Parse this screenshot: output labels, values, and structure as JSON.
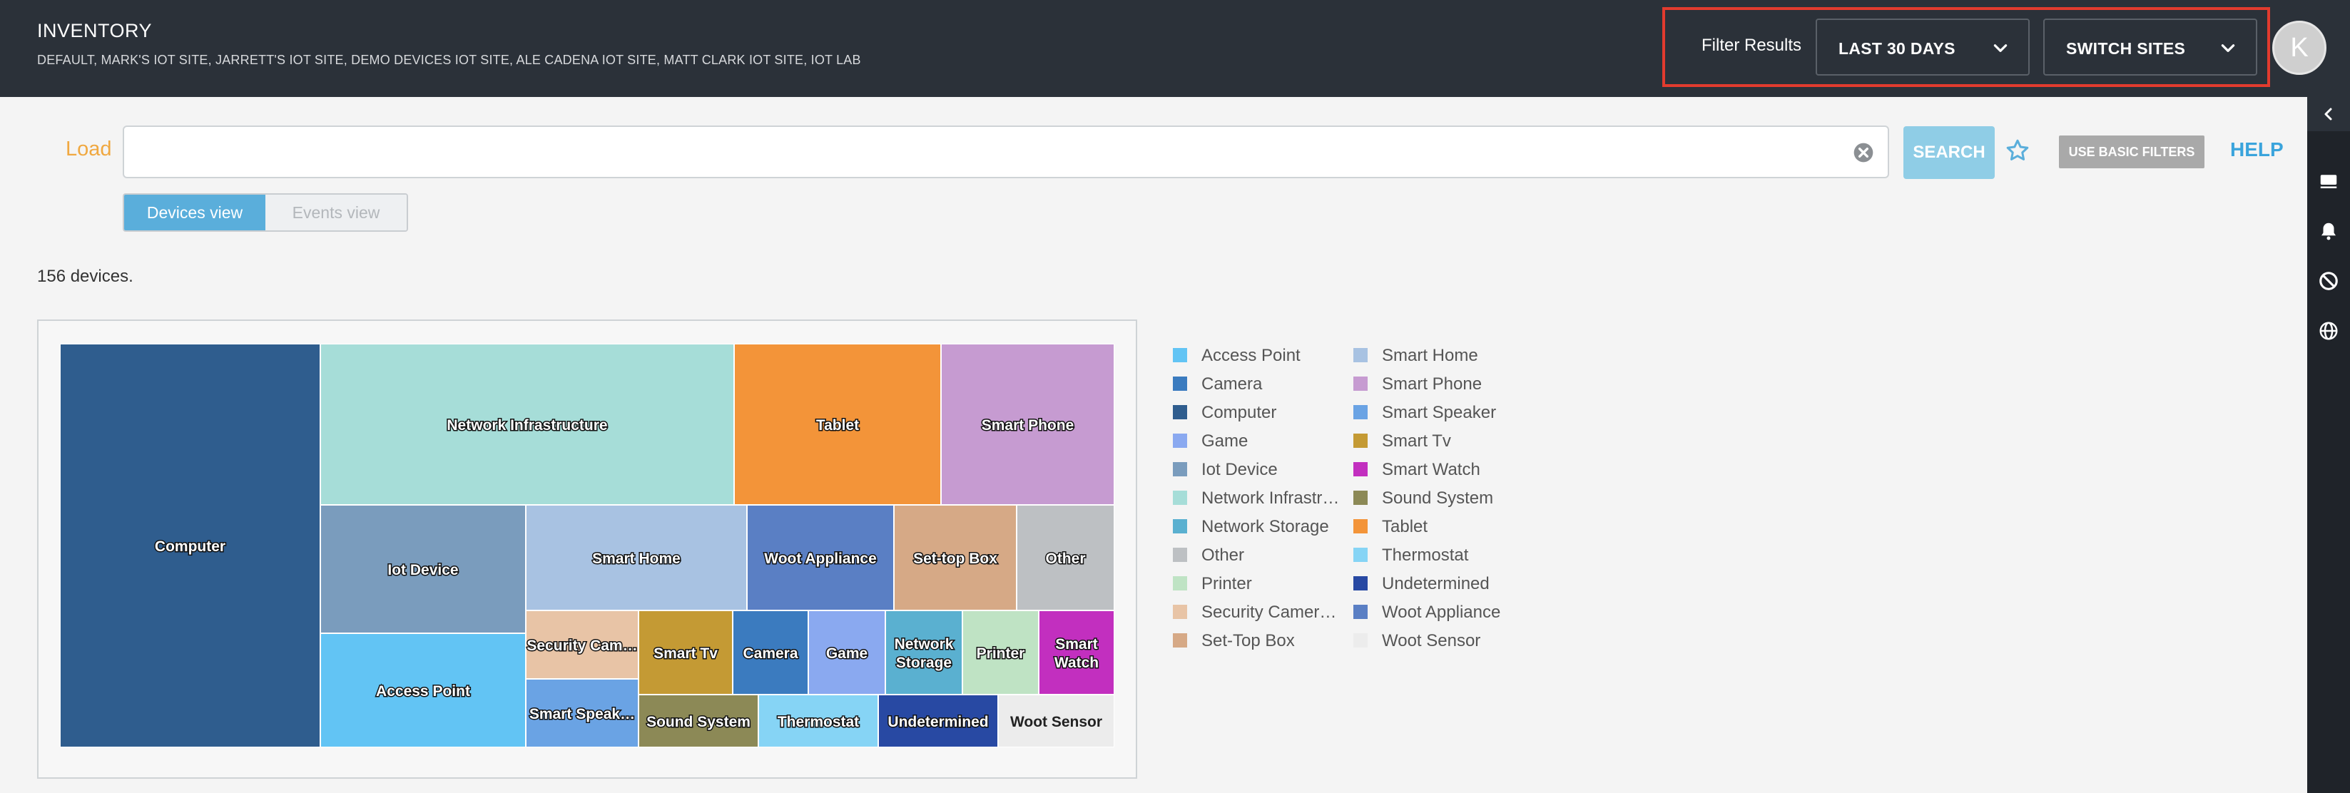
{
  "header": {
    "title": "INVENTORY",
    "sites": "DEFAULT, MARK'S IOT SITE, JARRETT'S IOT SITE, DEMO DEVICES IOT SITE, ALE CADENA IOT SITE, MATT CLARK IOT SITE, IOT LAB",
    "filter_label": "Filter Results",
    "range_label": "LAST 30 DAYS",
    "switch_label": "SWITCH SITES",
    "avatar_letter": "K"
  },
  "query": {
    "load_label": "Load",
    "value": "",
    "search_label": "SEARCH",
    "basic_filters_label": "USE BASIC FILTERS",
    "help_label": "HELP"
  },
  "views": {
    "devices": "Devices view",
    "events": "Events view"
  },
  "summary": {
    "count_text": "156 devices."
  },
  "icons": {
    "clear": "clear-circle-icon",
    "star": "star-icon",
    "chevron": "chevron-down-icon",
    "rail": [
      "chevron-left-icon",
      "device-icon",
      "alert-bell-icon",
      "block-icon",
      "globe-icon"
    ]
  },
  "chart_data": {
    "type": "treemap",
    "legend_placement": "right",
    "legend": [
      {
        "label": "Access Point",
        "color": "#62c4f4"
      },
      {
        "label": "Camera",
        "color": "#3b7bbf"
      },
      {
        "label": "Computer",
        "color": "#2f5d8e"
      },
      {
        "label": "Game",
        "color": "#8aa9f0"
      },
      {
        "label": "Iot Device",
        "color": "#7a9cbd"
      },
      {
        "label": "Network Infrastr…",
        "color": "#a6ddd8"
      },
      {
        "label": "Network Storage",
        "color": "#5ab0d0"
      },
      {
        "label": "Other",
        "color": "#bdc0c3"
      },
      {
        "label": "Printer",
        "color": "#bfe3c4"
      },
      {
        "label": "Security Camer…",
        "color": "#e8c4a6"
      },
      {
        "label": "Set-Top Box",
        "color": "#d6a986"
      },
      {
        "label": "Smart Home",
        "color": "#a8c2e2"
      },
      {
        "label": "Smart Phone",
        "color": "#c69bd1"
      },
      {
        "label": "Smart Speaker",
        "color": "#6aa3e4"
      },
      {
        "label": "Smart Tv",
        "color": "#c49a34"
      },
      {
        "label": "Smart Watch",
        "color": "#c22fbf"
      },
      {
        "label": "Sound System",
        "color": "#8c8956"
      },
      {
        "label": "Tablet",
        "color": "#f39439"
      },
      {
        "label": "Thermostat",
        "color": "#86d4f5"
      },
      {
        "label": "Undetermined",
        "color": "#2849a3"
      },
      {
        "label": "Woot Appliance",
        "color": "#5a7fc4"
      },
      {
        "label": "Woot Sensor",
        "color": "#ececec"
      }
    ],
    "tiles": [
      {
        "label": "Computer",
        "color": "#2f5d8e"
      },
      {
        "label": "Network Infrastructure",
        "color": "#a6ddd8"
      },
      {
        "label": "Tablet",
        "color": "#f39439"
      },
      {
        "label": "Smart Phone",
        "color": "#c69bd1"
      },
      {
        "label": "Iot Device",
        "color": "#7a9cbd"
      },
      {
        "label": "Access Point",
        "color": "#62c4f4"
      },
      {
        "label": "Smart Home",
        "color": "#a8c2e2"
      },
      {
        "label": "Woot Appliance",
        "color": "#5a7fc4"
      },
      {
        "label": "Set-top Box",
        "color": "#d6a986"
      },
      {
        "label": "Other",
        "color": "#bdc0c3"
      },
      {
        "label": "Security Cam…",
        "color": "#e8c4a6"
      },
      {
        "label": "Smart Speak…",
        "color": "#6aa3e4"
      },
      {
        "label": "Smart Tv",
        "color": "#c49a34"
      },
      {
        "label": "Sound System",
        "color": "#8c8956"
      },
      {
        "label": "Camera",
        "color": "#3b7bbf"
      },
      {
        "label": "Game",
        "color": "#8aa9f0"
      },
      {
        "label": "Network Storage",
        "color": "#5ab0d0"
      },
      {
        "label": "Printer",
        "color": "#bfe3c4"
      },
      {
        "label": "Smart Watch",
        "color": "#c22fbf"
      },
      {
        "label": "Thermostat",
        "color": "#86d4f5"
      },
      {
        "label": "Undetermined",
        "color": "#2849a3"
      },
      {
        "label": "Woot Sensor",
        "color": "#ececec"
      }
    ]
  }
}
